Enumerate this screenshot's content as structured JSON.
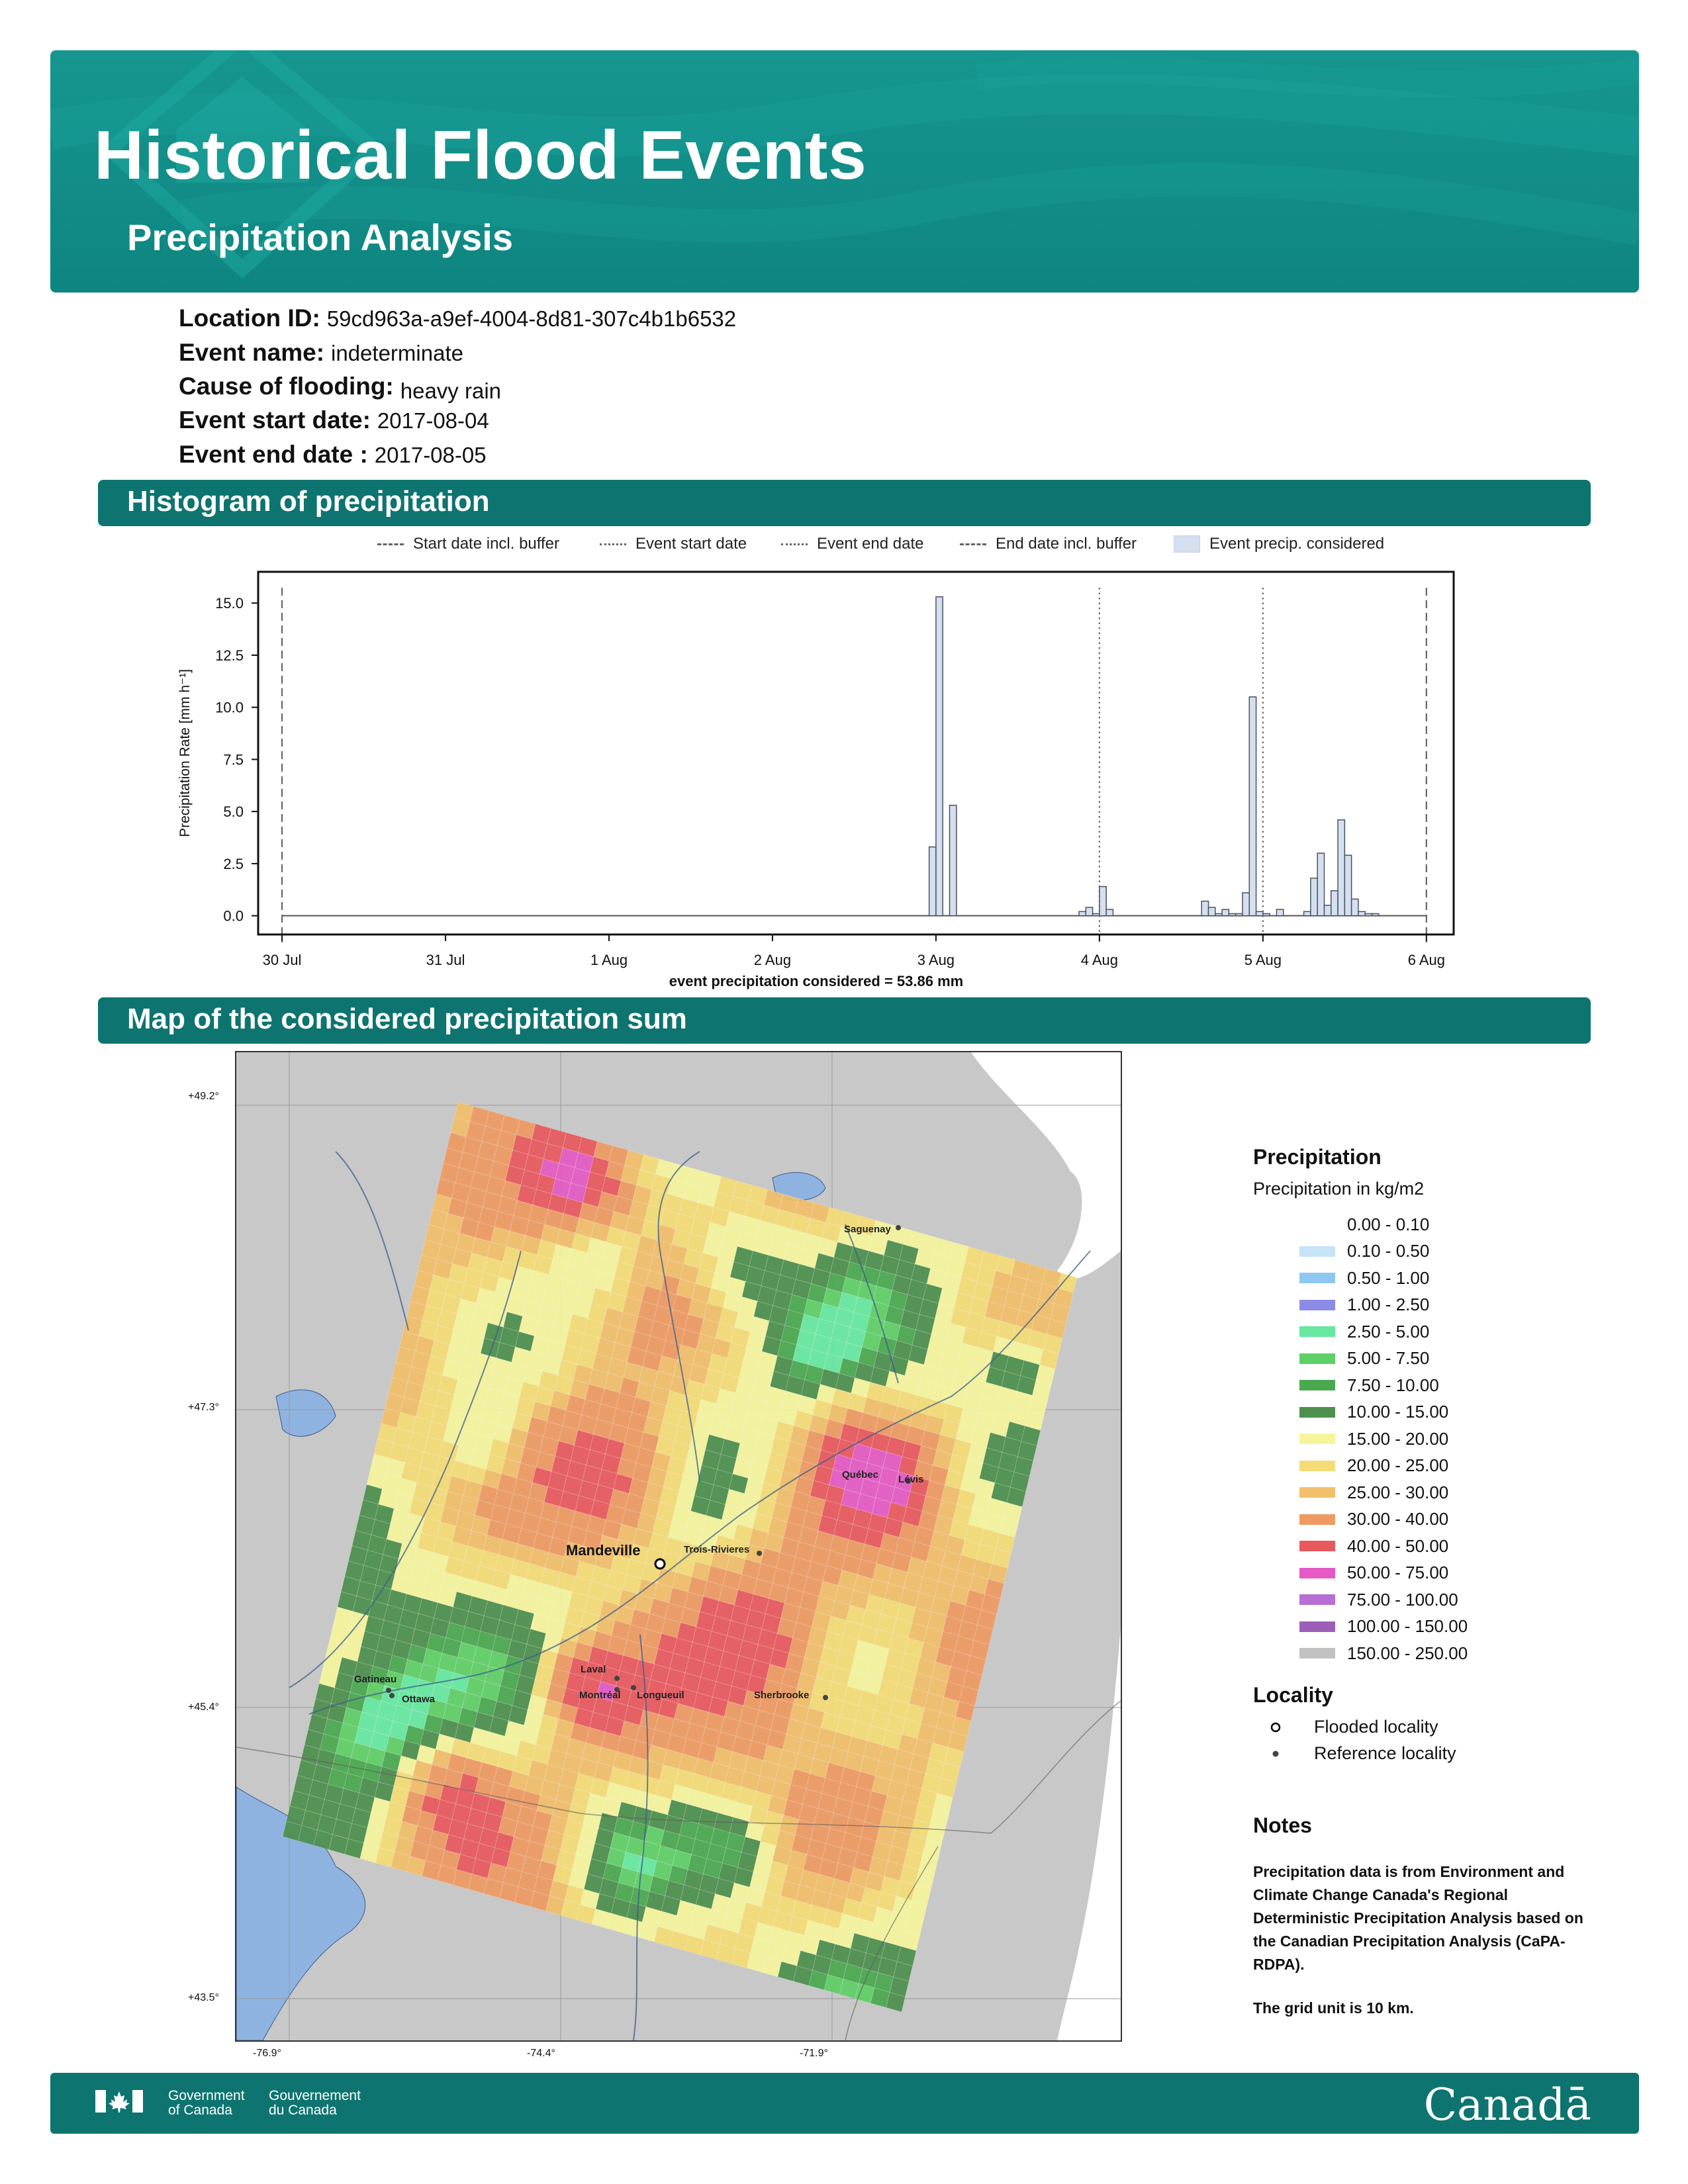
{
  "header": {
    "title": "Historical Flood Events",
    "subtitle": "Precipitation Analysis"
  },
  "event": {
    "location_id_label": "Location ID:",
    "location_id": "59cd963a-a9ef-4004-8d81-307c4b1b6532",
    "event_name_label": "Event name:",
    "event_name": "indeterminate",
    "cause_label": "Cause of flooding:",
    "cause": "heavy rain",
    "start_label": "Event start date:",
    "start": "2017-08-04",
    "end_label": "Event end date :",
    "end": "2017-08-05"
  },
  "sections": {
    "histogram": "Histogram of precipitation",
    "map": "Map of the considered precipitation sum"
  },
  "chart_data": {
    "type": "bar",
    "ylabel": "Precipitation Rate [mm h⁻¹]",
    "xlabel": "event precipitation considered = 53.86 mm",
    "ylim": [
      -0.9,
      16.5
    ],
    "xlim": [
      "2017-07-29 20:30",
      "2017-08-06 04:00"
    ],
    "yticks": [
      "0.0",
      "2.5",
      "5.0",
      "7.5",
      "10.0",
      "12.5",
      "15.0"
    ],
    "ytick_values": [
      0,
      2.5,
      5,
      7.5,
      10,
      12.5,
      15
    ],
    "xtick_labels": [
      "30 Jul",
      "31 Jul",
      "1 Aug",
      "2 Aug",
      "3 Aug",
      "4 Aug",
      "5 Aug",
      "6 Aug"
    ],
    "xtick_values": [
      "2017-07-30 00:00",
      "2017-07-31 00:00",
      "2017-08-01 00:00",
      "2017-08-02 00:00",
      "2017-08-03 00:00",
      "2017-08-04 00:00",
      "2017-08-05 00:00",
      "2017-08-06 00:00"
    ],
    "legend": [
      {
        "label": "Start date incl. buffer",
        "style": "dashed"
      },
      {
        "label": "Event start date",
        "style": "dotted"
      },
      {
        "label": "Event end date",
        "style": "dotted"
      },
      {
        "label": "End date incl. buffer",
        "style": "dashed"
      },
      {
        "label": "Event precip. considered",
        "style": "fill"
      }
    ],
    "vlines": [
      {
        "x": "2017-07-30 00:00",
        "style": "dashed"
      },
      {
        "x": "2017-08-04 00:00",
        "style": "dotted"
      },
      {
        "x": "2017-08-05 00:00",
        "style": "dotted"
      },
      {
        "x": "2017-08-06 00:00",
        "style": "dashed"
      }
    ],
    "bar_hours": 1,
    "bars": [
      {
        "start": "2017-08-02 23:00",
        "value": 3.3
      },
      {
        "start": "2017-08-03 00:00",
        "value": 15.3
      },
      {
        "start": "2017-08-03 01:00",
        "value": 0.0
      },
      {
        "start": "2017-08-03 02:00",
        "value": 5.3
      },
      {
        "start": "2017-08-03 03:00",
        "value": 0.0
      },
      {
        "start": "2017-08-03 21:00",
        "value": 0.2
      },
      {
        "start": "2017-08-03 22:00",
        "value": 0.4
      },
      {
        "start": "2017-08-03 23:00",
        "value": 0.1
      },
      {
        "start": "2017-08-04 00:00",
        "value": 1.4
      },
      {
        "start": "2017-08-04 01:00",
        "value": 0.3
      },
      {
        "start": "2017-08-04 15:00",
        "value": 0.7
      },
      {
        "start": "2017-08-04 16:00",
        "value": 0.4
      },
      {
        "start": "2017-08-04 17:00",
        "value": 0.1
      },
      {
        "start": "2017-08-04 18:00",
        "value": 0.3
      },
      {
        "start": "2017-08-04 19:00",
        "value": 0.1
      },
      {
        "start": "2017-08-04 20:00",
        "value": 0.1
      },
      {
        "start": "2017-08-04 21:00",
        "value": 1.1
      },
      {
        "start": "2017-08-04 22:00",
        "value": 10.5
      },
      {
        "start": "2017-08-04 23:00",
        "value": 0.2
      },
      {
        "start": "2017-08-05 00:00",
        "value": 0.1
      },
      {
        "start": "2017-08-05 02:00",
        "value": 0.3
      },
      {
        "start": "2017-08-05 06:00",
        "value": 0.2
      },
      {
        "start": "2017-08-05 07:00",
        "value": 1.8
      },
      {
        "start": "2017-08-05 08:00",
        "value": 3.0
      },
      {
        "start": "2017-08-05 09:00",
        "value": 0.5
      },
      {
        "start": "2017-08-05 10:00",
        "value": 1.2
      },
      {
        "start": "2017-08-05 11:00",
        "value": 4.6
      },
      {
        "start": "2017-08-05 12:00",
        "value": 2.9
      },
      {
        "start": "2017-08-05 13:00",
        "value": 0.8
      },
      {
        "start": "2017-08-05 14:00",
        "value": 0.2
      },
      {
        "start": "2017-08-05 15:00",
        "value": 0.1
      },
      {
        "start": "2017-08-05 16:00",
        "value": 0.1
      }
    ]
  },
  "map": {
    "lat_labels": [
      "+49.2°",
      "+47.3°",
      "+45.4°",
      "+43.5°"
    ],
    "lon_labels": [
      "-76.9°",
      "-74.4°",
      "-71.9°"
    ],
    "flooded_locality": "Mandeville",
    "reference_localities": [
      "Saguenay",
      "Québec",
      "Lévis",
      "Trois-Rivieres",
      "Gatineau",
      "Ottawa",
      "Laval",
      "Montréal",
      "Longueuil",
      "Sherbrooke"
    ]
  },
  "legend": {
    "title": "Precipitation",
    "subtitle": "Precipitation in kg/m2",
    "classes": [
      {
        "label": "0.00 - 0.10",
        "color": "#ffffff"
      },
      {
        "label": "0.10 - 0.50",
        "color": "#c6e3f7"
      },
      {
        "label": "0.50 - 1.00",
        "color": "#8ec8f0"
      },
      {
        "label": "1.00 - 2.50",
        "color": "#8c8ce6"
      },
      {
        "label": "2.50 - 5.00",
        "color": "#66e8a0"
      },
      {
        "label": "5.00 - 7.50",
        "color": "#5fcf67"
      },
      {
        "label": "7.50 - 10.00",
        "color": "#4aa84f"
      },
      {
        "label": "10.00 - 15.00",
        "color": "#4d8f4d"
      },
      {
        "label": "15.00 - 20.00",
        "color": "#f6f59c"
      },
      {
        "label": "20.00 - 25.00",
        "color": "#f5dc76"
      },
      {
        "label": "25.00 - 30.00",
        "color": "#f2bf6a"
      },
      {
        "label": "30.00 - 40.00",
        "color": "#ee9a62"
      },
      {
        "label": "40.00 - 50.00",
        "color": "#e8595e"
      },
      {
        "label": "50.00 - 75.00",
        "color": "#e55ac4"
      },
      {
        "label": "75.00 - 100.00",
        "color": "#b66fd4"
      },
      {
        "label": "100.00 - 150.00",
        "color": "#9b5fb8"
      },
      {
        "label": "150.00 - 250.00",
        "color": "#c2c2c2"
      }
    ],
    "locality_title": "Locality",
    "flooded_label": "Flooded locality",
    "reference_label": "Reference locality",
    "notes_title": "Notes",
    "notes_text": "Precipitation data is from Environment and Climate Change Canada's Regional Deterministic Precipitation Analysis based on the Canadian Precipitation Analysis (CaPA-RDPA).",
    "notes_grid": "The grid unit is 10 km."
  },
  "footer": {
    "gov_en_1": "Government",
    "gov_en_2": "of Canada",
    "gov_fr_1": "Gouvernement",
    "gov_fr_2": "du Canada",
    "wordmark": "Canadā"
  },
  "colors": {
    "banner": "#0e8580",
    "section": "#0e7470",
    "bar_fill": "#d6dff0",
    "water": "#8fb3e0",
    "land": "#c8c8c8"
  }
}
